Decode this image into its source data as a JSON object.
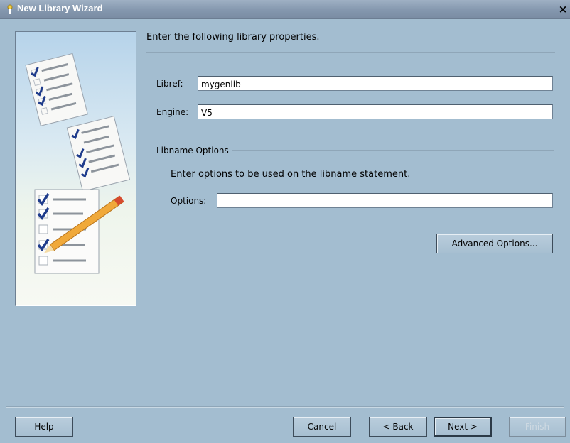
{
  "window": {
    "title": "New Library Wizard",
    "close_glyph": "×"
  },
  "main": {
    "heading": "Enter the following library properties.",
    "libref": {
      "label": "Libref:",
      "value": "mygenlib"
    },
    "engine": {
      "label": "Engine:",
      "value": "V5"
    },
    "libname_options": {
      "group_label": "Libname Options",
      "instruction": "Enter options to be used on the libname statement.",
      "options_label": "Options:",
      "options_value": ""
    },
    "advanced_button": "Advanced Options..."
  },
  "footer": {
    "help": "Help",
    "cancel": "Cancel",
    "back": "< Back",
    "next": "Next >",
    "finish": "Finish"
  },
  "colors": {
    "background": "#a3bdd0",
    "titlebar": "#8497ae",
    "check": "#1f3c8c"
  },
  "icons": [
    "wizard-app-icon",
    "close-icon",
    "checklist-illustration",
    "pencil-icon"
  ]
}
